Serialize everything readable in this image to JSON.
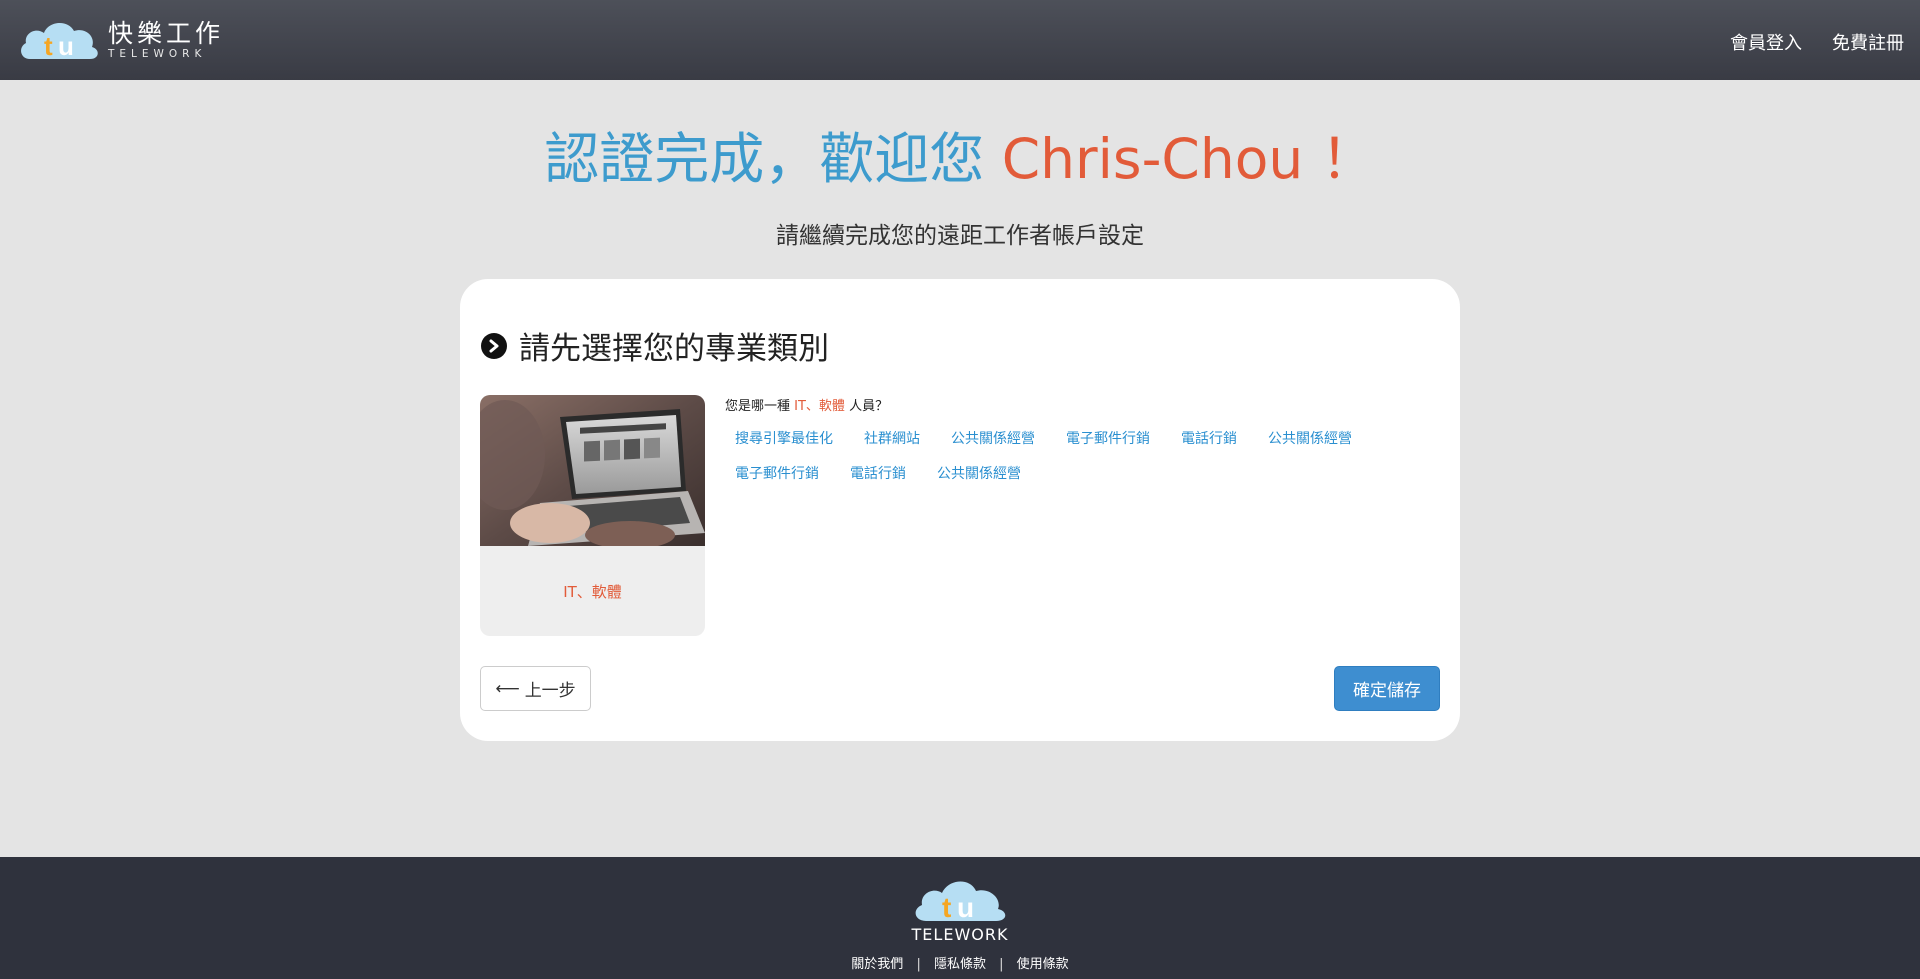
{
  "header": {
    "brand_cn": "快樂工作",
    "brand_en": "TELEWORK",
    "nav": [
      {
        "label": "會員登入"
      },
      {
        "label": "免費註冊"
      }
    ]
  },
  "hero": {
    "title_prefix": "認證完成，歡迎您",
    "user_name": "Chris-Chou",
    "title_suffix": "！",
    "subtitle": "請繼續完成您的遠距工作者帳戶設定"
  },
  "card": {
    "section_title": "請先選擇您的專業類別",
    "category": {
      "label": "IT、軟體"
    },
    "question": {
      "prefix": "您是哪一種",
      "highlight": "IT、軟體",
      "suffix": "人員？"
    },
    "tags": [
      "搜尋引擎最佳化",
      "社群網站",
      "公共關係經營",
      "電子郵件行銷",
      "電話行銷",
      "公共關係經營",
      "電子郵件行銷",
      "電話行銷",
      "公共關係經營"
    ],
    "back_label": "上一步",
    "save_label": "確定儲存"
  },
  "footer": {
    "brand": "TELEWORK",
    "links": [
      "關於我們",
      "隱私條款",
      "使用條款"
    ]
  },
  "colors": {
    "accent_blue": "#3d9bcd",
    "accent_orange": "#e25b39",
    "link_blue": "#2a8fd0",
    "button_blue": "#3e8ed0",
    "header_bg": "#43464f",
    "footer_bg": "#2f323d"
  }
}
